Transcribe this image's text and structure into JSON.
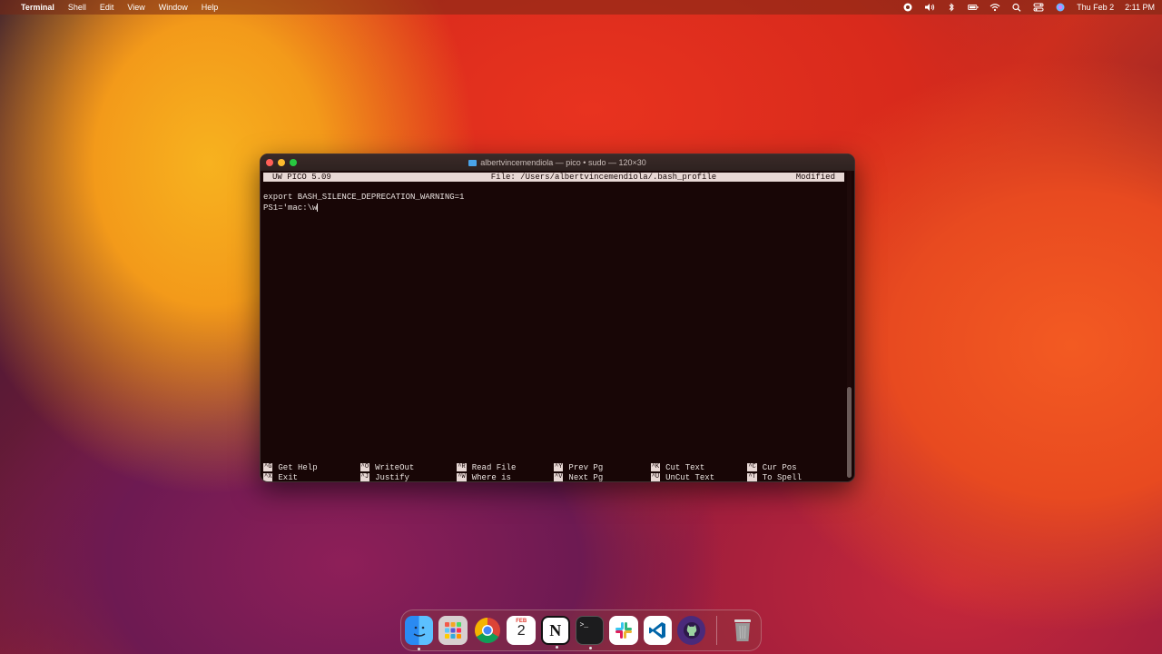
{
  "menubar": {
    "apple": "",
    "app": "Terminal",
    "menus": [
      "Shell",
      "Edit",
      "View",
      "Window",
      "Help"
    ],
    "date": "Thu Feb 2",
    "time": "2:11 PM"
  },
  "window": {
    "title": "albertvincemendiola — pico • sudo — 120×30"
  },
  "pico": {
    "version": "UW PICO 5.09",
    "file": "File: /Users/albertvincemendiola/.bash_profile",
    "status": "Modified",
    "lines": [
      "export BASH_SILENCE_DEPRECATION_WARNING=1",
      "PS1='mac:\\w"
    ],
    "shortcuts_row1": [
      {
        "key": "^G",
        "label": "Get Help"
      },
      {
        "key": "^O",
        "label": "WriteOut"
      },
      {
        "key": "^R",
        "label": "Read File"
      },
      {
        "key": "^Y",
        "label": "Prev Pg"
      },
      {
        "key": "^K",
        "label": "Cut Text"
      },
      {
        "key": "^C",
        "label": "Cur Pos"
      }
    ],
    "shortcuts_row2": [
      {
        "key": "^X",
        "label": "Exit"
      },
      {
        "key": "^J",
        "label": "Justify"
      },
      {
        "key": "^W",
        "label": "Where is"
      },
      {
        "key": "^V",
        "label": "Next Pg"
      },
      {
        "key": "^U",
        "label": "UnCut Text"
      },
      {
        "key": "^T",
        "label": "To Spell"
      }
    ]
  },
  "dock": {
    "calendar_month": "FEB",
    "calendar_day": "2",
    "notion_letter": "N",
    "terminal_prompt": ">_"
  }
}
